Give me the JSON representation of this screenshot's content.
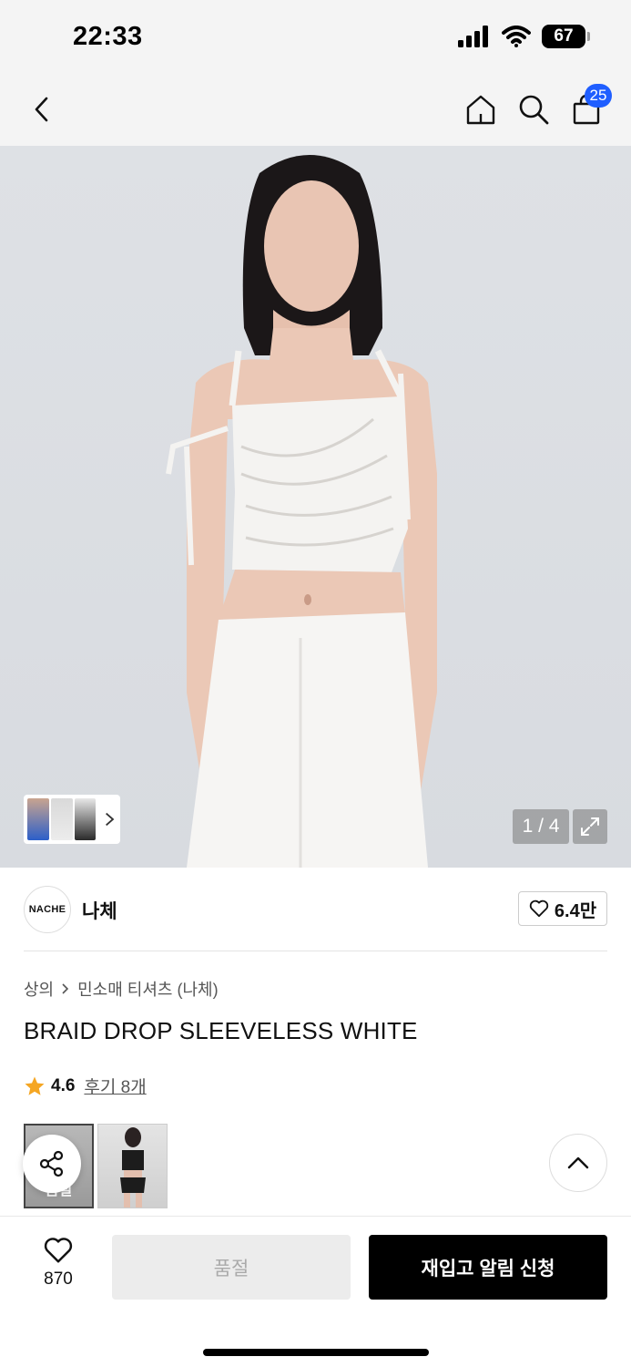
{
  "status_bar": {
    "time": "22:33",
    "battery": "67"
  },
  "nav": {
    "cart_count": "25"
  },
  "hero": {
    "counter": "1 / 4"
  },
  "brand": {
    "logo_text": "NACHE",
    "name": "나체",
    "likes": "6.4만"
  },
  "product": {
    "breadcrumb": [
      "상의",
      "민소매 티셔츠 (나체)"
    ],
    "title": "BRAID DROP SLEEVELESS WHITE",
    "rating": "4.6",
    "reviews": "후기 8개"
  },
  "options": {
    "soldout_label": "품절"
  },
  "bottom": {
    "wish_count": "870",
    "soldout_button": "품절",
    "restock_button": "재입고 알림 신청"
  },
  "colors": {
    "accent_blue": "#1f5eff",
    "star": "#f5a623"
  }
}
